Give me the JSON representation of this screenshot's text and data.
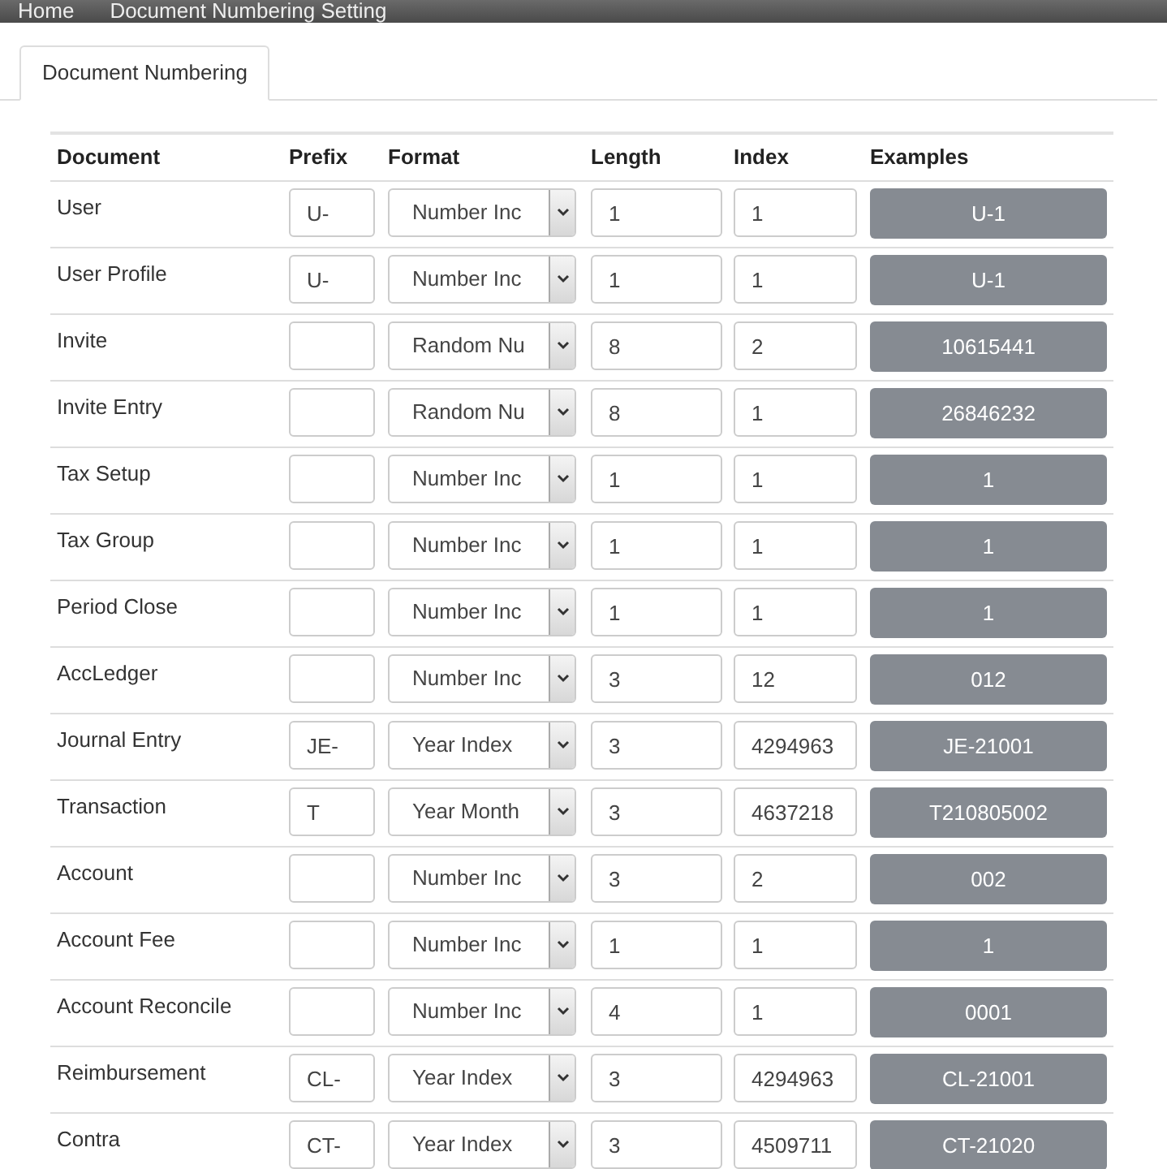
{
  "breadcrumb": [
    "Home",
    "Document Numbering Setting"
  ],
  "tabs": [
    {
      "label": "Document Numbering",
      "selected": true
    }
  ],
  "table": {
    "columns": [
      "Document",
      "Prefix",
      "Format",
      "Length",
      "Index",
      "Examples"
    ],
    "rows": [
      {
        "document": "User",
        "prefix": "U-",
        "format": "Number Inc",
        "length": "1",
        "index": "1",
        "example": "U-1"
      },
      {
        "document": "User Profile",
        "prefix": "U-",
        "format": "Number Inc",
        "length": "1",
        "index": "1",
        "example": "U-1"
      },
      {
        "document": "Invite",
        "prefix": "",
        "format": "Random Nu",
        "length": "8",
        "index": "2",
        "example": "10615441"
      },
      {
        "document": "Invite Entry",
        "prefix": "",
        "format": "Random Nu",
        "length": "8",
        "index": "1",
        "example": "26846232"
      },
      {
        "document": "Tax Setup",
        "prefix": "",
        "format": "Number Inc",
        "length": "1",
        "index": "1",
        "example": "1"
      },
      {
        "document": "Tax Group",
        "prefix": "",
        "format": "Number Inc",
        "length": "1",
        "index": "1",
        "example": "1"
      },
      {
        "document": "Period Close",
        "prefix": "",
        "format": "Number Inc",
        "length": "1",
        "index": "1",
        "example": "1"
      },
      {
        "document": "AccLedger",
        "prefix": "",
        "format": "Number Inc",
        "length": "3",
        "index": "12",
        "example": "012"
      },
      {
        "document": "Journal Entry",
        "prefix": "JE-",
        "format": "Year Index",
        "length": "3",
        "index": "4294963",
        "example": "JE-21001"
      },
      {
        "document": "Transaction",
        "prefix": "T",
        "format": "Year Month",
        "length": "3",
        "index": "4637218",
        "example": "T210805002"
      },
      {
        "document": "Account",
        "prefix": "",
        "format": "Number Inc",
        "length": "3",
        "index": "2",
        "example": "002"
      },
      {
        "document": "Account Fee",
        "prefix": "",
        "format": "Number Inc",
        "length": "1",
        "index": "1",
        "example": "1"
      },
      {
        "document": "Account Reconcile",
        "prefix": "",
        "format": "Number Inc",
        "length": "4",
        "index": "1",
        "example": "0001"
      },
      {
        "document": "Reimbursement",
        "prefix": "CL-",
        "format": "Year Index",
        "length": "3",
        "index": "4294963",
        "example": "CL-21001"
      },
      {
        "document": "Contra",
        "prefix": "CT-",
        "format": "Year Index",
        "length": "3",
        "index": "4509711",
        "example": "CT-21020"
      }
    ]
  }
}
